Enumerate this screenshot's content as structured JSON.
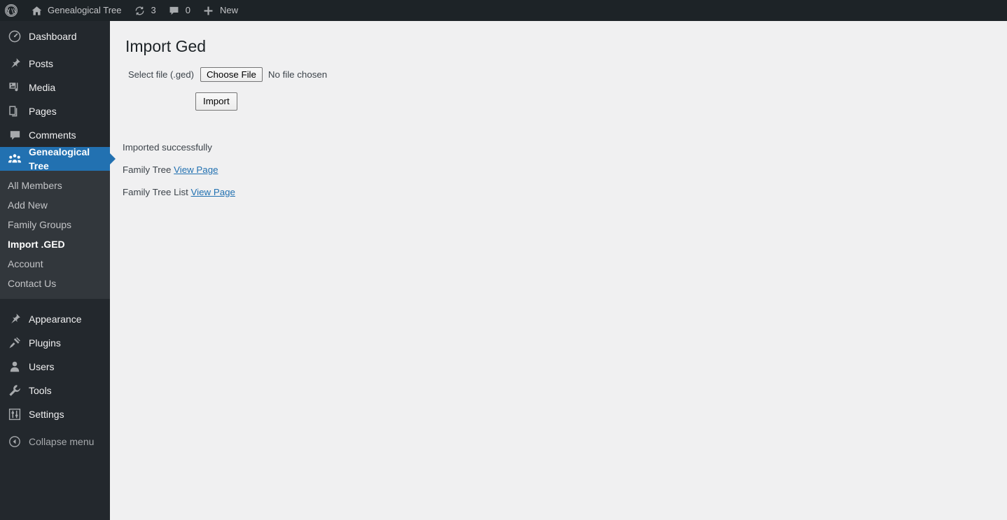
{
  "adminbar": {
    "wp_logo_icon": "wordpress-logo-icon",
    "site_home_icon": "home-icon",
    "site_name": "Genealogical Tree",
    "updates_icon": "updates-icon",
    "updates_count": "3",
    "comments_icon": "comment-bubble-icon",
    "comments_count": "0",
    "new_icon": "plus-icon",
    "new_label": "New"
  },
  "sidebar": {
    "items": [
      {
        "label": "Dashboard",
        "icon": "dashboard-gauge-icon",
        "current": false
      },
      {
        "label": "Posts",
        "icon": "pin-icon",
        "current": false
      },
      {
        "label": "Media",
        "icon": "media-icon",
        "current": false
      },
      {
        "label": "Pages",
        "icon": "pages-icon",
        "current": false
      },
      {
        "label": "Comments",
        "icon": "comment-bubble-icon",
        "current": false
      },
      {
        "label": "Genealogical Tree",
        "icon": "group-people-icon",
        "current": true
      },
      {
        "label": "Appearance",
        "icon": "paintbrush-icon",
        "current": false
      },
      {
        "label": "Plugins",
        "icon": "plug-icon",
        "current": false
      },
      {
        "label": "Users",
        "icon": "user-icon",
        "current": false
      },
      {
        "label": "Tools",
        "icon": "wrench-icon",
        "current": false
      },
      {
        "label": "Settings",
        "icon": "sliders-icon",
        "current": false
      }
    ],
    "submenu": [
      {
        "label": "All Members",
        "current": false
      },
      {
        "label": "Add New",
        "current": false
      },
      {
        "label": "Family Groups",
        "current": false
      },
      {
        "label": "Import .GED",
        "current": true
      },
      {
        "label": "Account",
        "current": false
      },
      {
        "label": "Contact Us",
        "current": false
      }
    ],
    "collapse": {
      "label": "Collapse menu",
      "icon": "collapse-arrow-icon"
    }
  },
  "main": {
    "page_title": "Import Ged",
    "file_field": {
      "label": "Select file (.ged)",
      "button_label": "Choose File",
      "status": "No file chosen"
    },
    "import_button_label": "Import",
    "results": {
      "status_message": "Imported successfully",
      "rows": [
        {
          "text": "Family Tree",
          "link": "View Page"
        },
        {
          "text": "Family Tree List",
          "link": "View Page"
        }
      ]
    }
  },
  "colors": {
    "adminbar_bg": "#1d2327",
    "sidebar_bg": "#23282d",
    "submenu_bg": "#32373c",
    "accent": "#2271b1",
    "content_bg": "#f0f0f1",
    "link": "#2271b1"
  }
}
